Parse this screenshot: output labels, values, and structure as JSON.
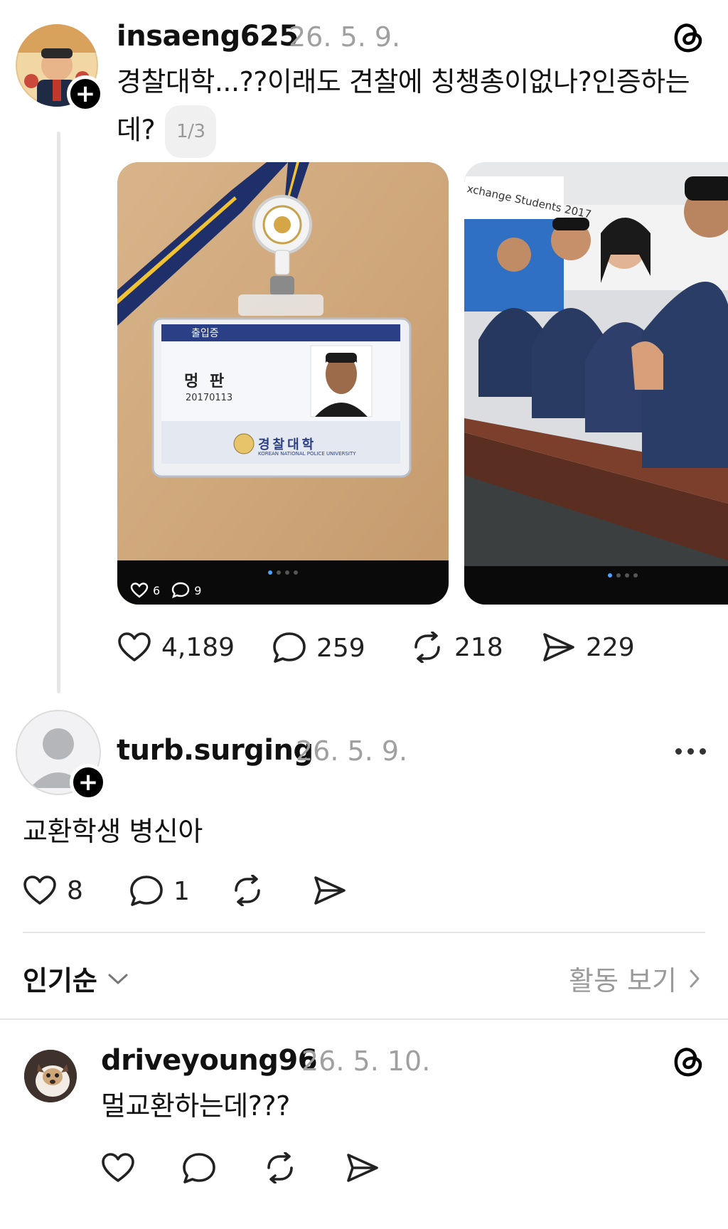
{
  "post": {
    "username": "insaeng625",
    "date": "26. 5. 9.",
    "text_line1": "경찰대학...??이래도 견찰에 칭챙총이없나?인증하는",
    "text_line2": "데?",
    "page_indicator": "1/3",
    "id_card": {
      "header": "출입증",
      "name": "멍 판",
      "number": "20170113",
      "school": "경찰대학",
      "school_en": "KOREAN NATIONAL POLICE UNIVERSITY"
    },
    "photo2_banner": "xchange Students 2017",
    "mini_counts": {
      "likes": "6",
      "comments": "9"
    },
    "stats": {
      "likes": "4,189",
      "comments": "259",
      "reposts": "218",
      "shares": "229"
    }
  },
  "reply1": {
    "username": "turb.surging",
    "date": "26. 5. 9.",
    "text": "교환학생 병신아",
    "likes": "8",
    "comments": "1"
  },
  "sort": {
    "label": "인기순",
    "activity": "활동 보기"
  },
  "reply2": {
    "username": "driveyoung96",
    "date": "26. 5. 10.",
    "text": "멀교환하는데???"
  },
  "icons": [
    "threads-logo-icon",
    "heart-icon",
    "comment-icon",
    "repost-icon",
    "share-icon",
    "more-icon",
    "chevron-down-icon",
    "chevron-right-icon",
    "plus-icon"
  ]
}
